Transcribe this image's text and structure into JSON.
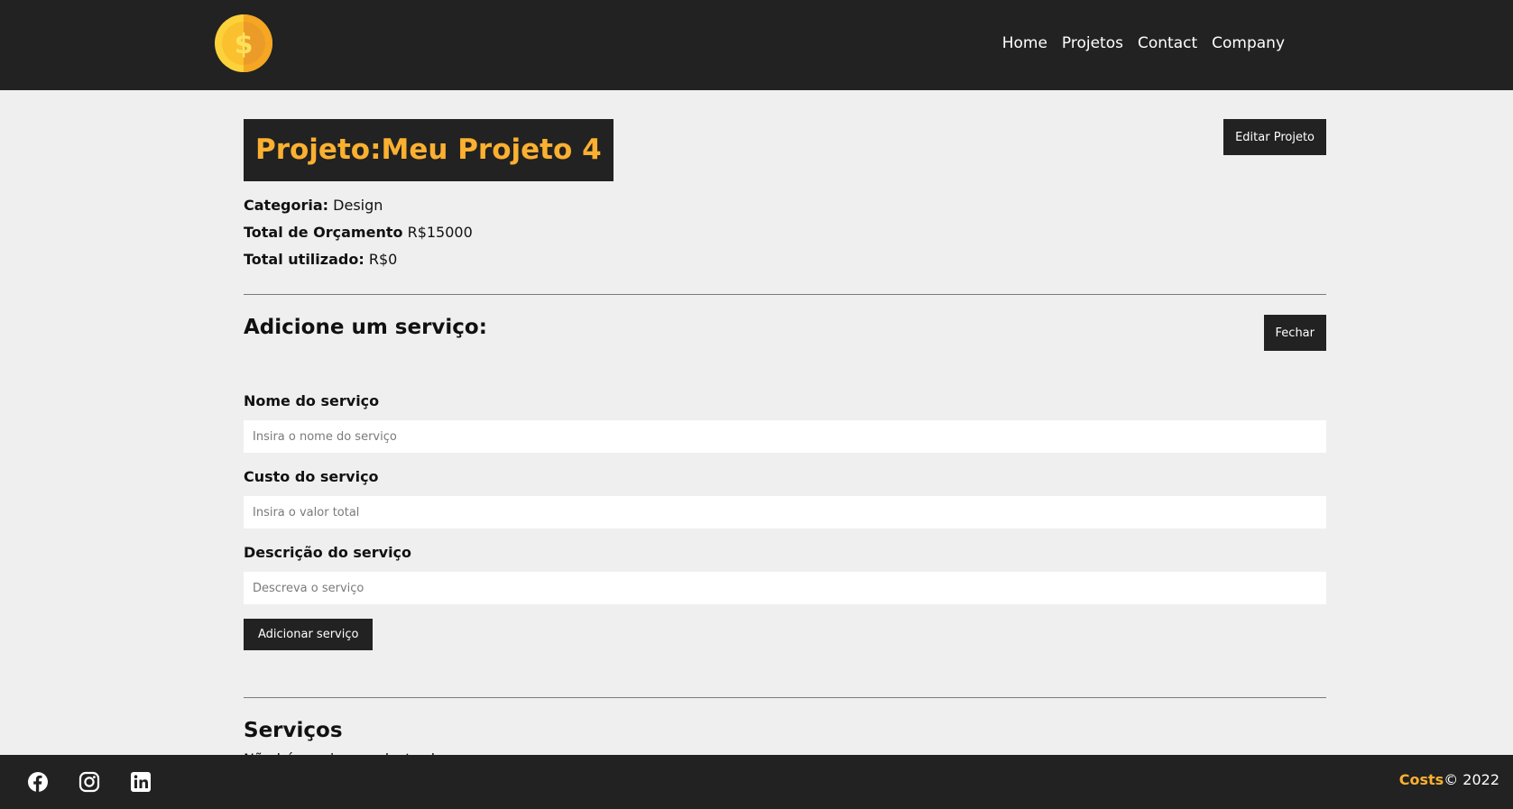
{
  "nav": {
    "logo_icon": "coin-dollar-icon",
    "links": [
      "Home",
      "Projetos",
      "Contact",
      "Company"
    ]
  },
  "project": {
    "title": "Projeto:Meu Projeto 4",
    "edit_button": "Editar Projeto",
    "category_label": "Categoria:",
    "category_value": "Design",
    "budget_label": "Total de Orçamento",
    "budget_value": "R$15000",
    "used_label": "Total utilizado:",
    "used_value": "R$0"
  },
  "service_form": {
    "title": "Adicione um serviço:",
    "close_button": "Fechar",
    "name_label": "Nome do serviço",
    "name_placeholder": "Insira o nome do serviço",
    "cost_label": "Custo do serviço",
    "cost_placeholder": "Insira o valor total",
    "description_label": "Descrição do serviço",
    "description_placeholder": "Descreva o serviço",
    "submit_button": "Adicionar serviço"
  },
  "services": {
    "title": "Serviços",
    "empty_text": "Não há serviços cadastrados."
  },
  "footer": {
    "brand": "Costs",
    "copyright": "© 2022",
    "social_icons": [
      "facebook-icon",
      "instagram-icon",
      "linkedin-icon"
    ]
  },
  "colors": {
    "dark": "#222222",
    "accent": "#fbb030",
    "background": "#efefef"
  }
}
